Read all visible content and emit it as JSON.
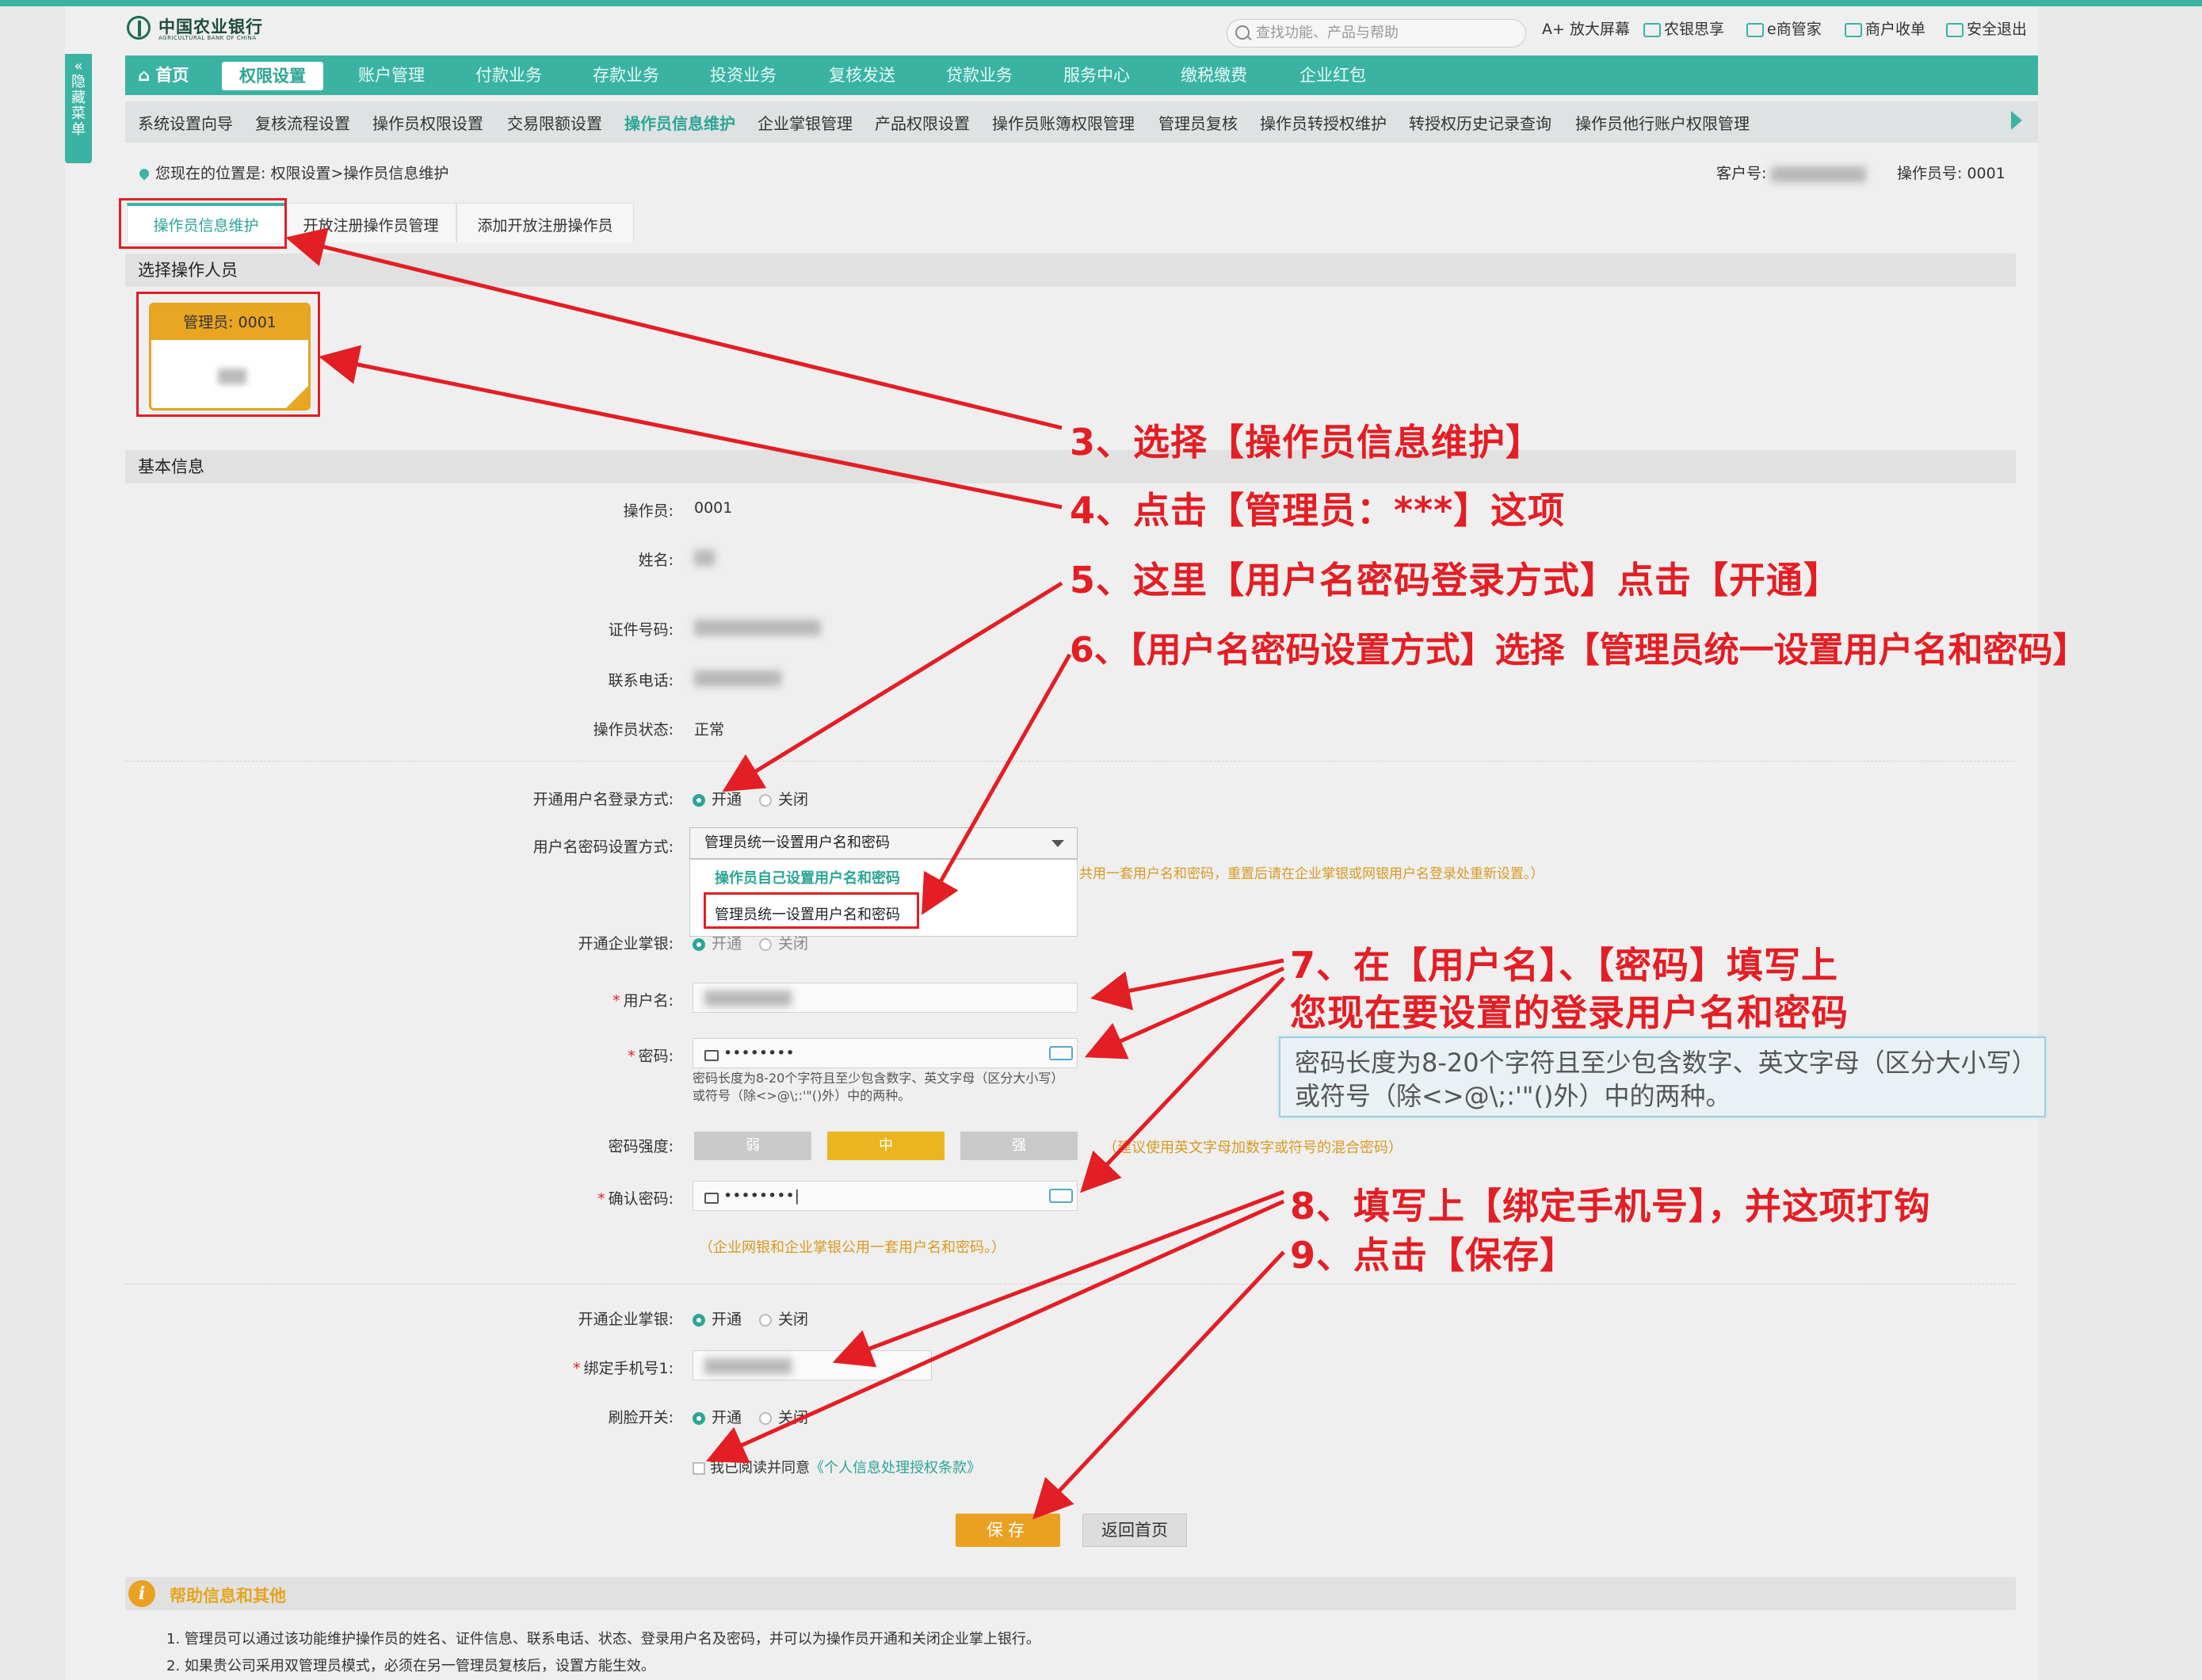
{
  "bank": {
    "name_cn": "中国农业银行",
    "name_en": "AGRICULTURAL BANK OF CHINA"
  },
  "side_tab": "隐藏菜单",
  "search": {
    "placeholder": "查找功能、产品与帮助"
  },
  "top_links": {
    "enlarge": "A+ 放大屏幕",
    "nongyin": "农银思享",
    "eshang": "e商管家",
    "shouyin": "商户收单",
    "logout": "安全退出"
  },
  "nav": [
    "首页",
    "权限设置",
    "账户管理",
    "付款业务",
    "存款业务",
    "投资业务",
    "复核发送",
    "贷款业务",
    "服务中心",
    "缴税缴费",
    "企业红包"
  ],
  "subnav": [
    "系统设置向导",
    "复核流程设置",
    "操作员权限设置",
    "交易限额设置",
    "操作员信息维护",
    "企业掌银管理",
    "产品权限设置",
    "操作员账簿权限管理",
    "管理员复核",
    "操作员转授权维护",
    "转授权历史记录查询",
    "操作员他行账户权限管理"
  ],
  "breadcrumb": "您现在的位置是: 权限设置>操作员信息维护",
  "customer": {
    "label": "客户号:",
    "operator_label": "操作员号:",
    "operator_no": "0001"
  },
  "tabs": [
    "操作员信息维护",
    "开放注册操作员管理",
    "添加开放注册操作员"
  ],
  "section_select": "选择操作人员",
  "operator_card": {
    "title": "管理员: 0001"
  },
  "section_basic": "基本信息",
  "fields": {
    "operator": {
      "label": "操作员:",
      "value": "0001"
    },
    "name": {
      "label": "姓名:"
    },
    "id_no": {
      "label": "证件号码:"
    },
    "phone": {
      "label": "联系电话:"
    },
    "status": {
      "label": "操作员状态:",
      "value": "正常"
    },
    "login_mode": {
      "label": "开通用户名登录方式:",
      "on": "开通",
      "off": "关闭"
    },
    "pwd_mode": {
      "label": "用户名密码设置方式:",
      "value": "管理员统一设置用户名和密码"
    },
    "mobile_bank": {
      "label": "开通企业掌银:",
      "on": "开通",
      "off": "关闭"
    },
    "username": {
      "label": "用户名:"
    },
    "password": {
      "label": "密码:",
      "masked": "••••••••",
      "hint1": "密码长度为8-20个字符且至少包含数字、英文字母（区分大小写）",
      "hint2": "或符号（除<>@\\;:'\"()外）中的两种。"
    },
    "strength": {
      "label": "密码强度:",
      "weak": "弱",
      "mid": "中",
      "strong": "强",
      "tip": "（建议使用英文字母加数字或符号的混合密码）"
    },
    "confirm": {
      "label": "确认密码:",
      "masked": "••••••••",
      "tip": "（企业网银和企业掌银公用一套用户名和密码。）"
    },
    "mobile_bank2": {
      "label": "开通企业掌银:",
      "on": "开通",
      "off": "关闭"
    },
    "bind_phone": {
      "label": "绑定手机号1:"
    },
    "face": {
      "label": "刷脸开关:",
      "on": "开通",
      "off": "关闭"
    },
    "agree": {
      "text": "我已阅读并同意",
      "link": "《个人信息处理授权条款》"
    }
  },
  "dropdown_options": [
    "操作员自己设置用户名和密码",
    "管理员统一设置用户名和密码"
  ],
  "bg_note": "共用一套用户名和密码，重置后请在企业掌银或网银用户名登录处重新设置。）",
  "buttons": {
    "save": "保存",
    "back": "返回首页"
  },
  "help": {
    "title": "帮助信息和其他",
    "lines": [
      "1. 管理员可以通过该功能维护操作员的姓名、证件信息、联系电话、状态、登录用户名及密码，并可以为操作员开通和关闭企业掌上银行。",
      "2. 如果贵公司采用双管理员模式，必须在另一管理员复核后，设置方能生效。"
    ]
  },
  "annotations": {
    "step3": "3、选择【操作员信息维护】",
    "step4": "4、点击【管理员：***】这项",
    "step5": "5、这里【用户名密码登录方式】点击【开通】",
    "step6": "6、【用户名密码设置方式】选择【管理员统一设置用户名和密码】",
    "step7a": "7、在【用户名】、【密码】填写上",
    "step7b": "您现在要设置的登录用户名和密码",
    "tip1": "密码长度为8-20个字符且至少包含数字、英文字母（区分大小写）",
    "tip2": "或符号（除<>@\\;:'\"()外）中的两种。",
    "step8": "8、填写上【绑定手机号】，并这项打钩",
    "step9": "9、点击【保存】"
  },
  "colors": {
    "brand": "#3bb3a3",
    "accent": "#eaa021",
    "annotation": "#e31e24"
  }
}
